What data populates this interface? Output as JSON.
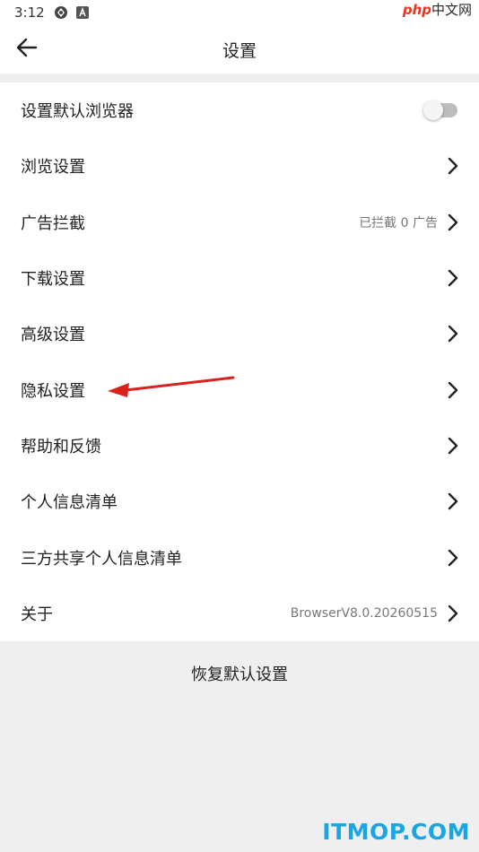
{
  "status_bar": {
    "time": "3:12",
    "icons": [
      "sync-icon",
      "a-icon"
    ]
  },
  "watermark_top": {
    "brand": "php",
    "suffix": "中文网"
  },
  "app_bar": {
    "title": "设置",
    "back_icon": "arrow-left-icon"
  },
  "settings": {
    "items": [
      {
        "label": "设置默认浏览器",
        "type": "toggle",
        "toggle_on": false
      },
      {
        "label": "浏览设置",
        "type": "link"
      },
      {
        "label": "广告拦截",
        "type": "link",
        "value": "已拦截 0 广告"
      },
      {
        "label": "下载设置",
        "type": "link"
      },
      {
        "label": "高级设置",
        "type": "link"
      },
      {
        "label": "隐私设置",
        "type": "link"
      },
      {
        "label": "帮助和反馈",
        "type": "link"
      },
      {
        "label": "个人信息清单",
        "type": "link"
      },
      {
        "label": "三方共享个人信息清单",
        "type": "link"
      },
      {
        "label": "关于",
        "type": "link",
        "value": "BrowserV8.0.20260515"
      }
    ]
  },
  "restore_label": "恢复默认设置",
  "watermark_bottom": "ITMOP.COM",
  "colors": {
    "background": "#efefef",
    "surface": "#ffffff",
    "annotation_arrow": "#d9221c",
    "watermark_blue": "#1aa6e4"
  }
}
